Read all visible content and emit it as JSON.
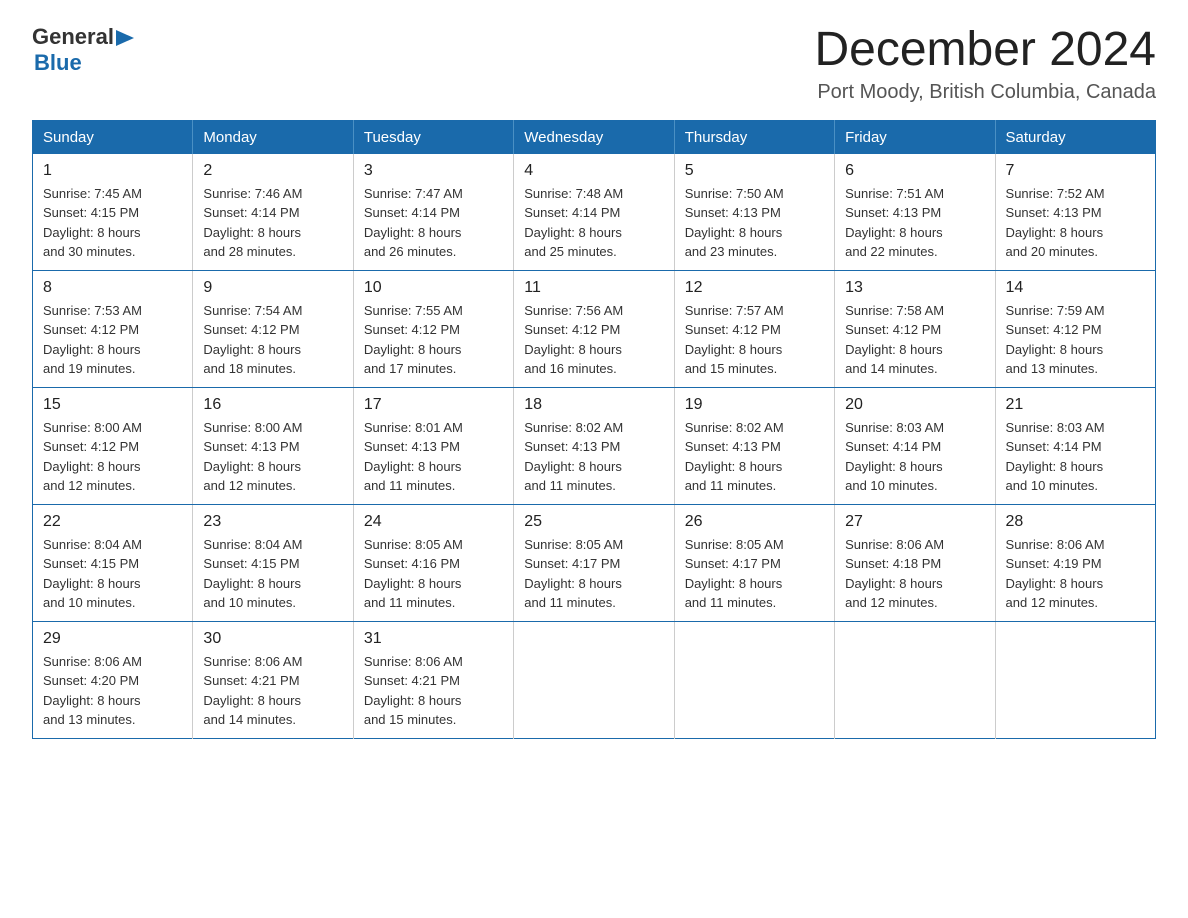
{
  "header": {
    "logo_general": "General",
    "logo_blue": "Blue",
    "month_title": "December 2024",
    "location": "Port Moody, British Columbia, Canada"
  },
  "days_of_week": [
    "Sunday",
    "Monday",
    "Tuesday",
    "Wednesday",
    "Thursday",
    "Friday",
    "Saturday"
  ],
  "weeks": [
    [
      {
        "day": "1",
        "sunrise": "Sunrise: 7:45 AM",
        "sunset": "Sunset: 4:15 PM",
        "daylight": "Daylight: 8 hours",
        "daylight2": "and 30 minutes."
      },
      {
        "day": "2",
        "sunrise": "Sunrise: 7:46 AM",
        "sunset": "Sunset: 4:14 PM",
        "daylight": "Daylight: 8 hours",
        "daylight2": "and 28 minutes."
      },
      {
        "day": "3",
        "sunrise": "Sunrise: 7:47 AM",
        "sunset": "Sunset: 4:14 PM",
        "daylight": "Daylight: 8 hours",
        "daylight2": "and 26 minutes."
      },
      {
        "day": "4",
        "sunrise": "Sunrise: 7:48 AM",
        "sunset": "Sunset: 4:14 PM",
        "daylight": "Daylight: 8 hours",
        "daylight2": "and 25 minutes."
      },
      {
        "day": "5",
        "sunrise": "Sunrise: 7:50 AM",
        "sunset": "Sunset: 4:13 PM",
        "daylight": "Daylight: 8 hours",
        "daylight2": "and 23 minutes."
      },
      {
        "day": "6",
        "sunrise": "Sunrise: 7:51 AM",
        "sunset": "Sunset: 4:13 PM",
        "daylight": "Daylight: 8 hours",
        "daylight2": "and 22 minutes."
      },
      {
        "day": "7",
        "sunrise": "Sunrise: 7:52 AM",
        "sunset": "Sunset: 4:13 PM",
        "daylight": "Daylight: 8 hours",
        "daylight2": "and 20 minutes."
      }
    ],
    [
      {
        "day": "8",
        "sunrise": "Sunrise: 7:53 AM",
        "sunset": "Sunset: 4:12 PM",
        "daylight": "Daylight: 8 hours",
        "daylight2": "and 19 minutes."
      },
      {
        "day": "9",
        "sunrise": "Sunrise: 7:54 AM",
        "sunset": "Sunset: 4:12 PM",
        "daylight": "Daylight: 8 hours",
        "daylight2": "and 18 minutes."
      },
      {
        "day": "10",
        "sunrise": "Sunrise: 7:55 AM",
        "sunset": "Sunset: 4:12 PM",
        "daylight": "Daylight: 8 hours",
        "daylight2": "and 17 minutes."
      },
      {
        "day": "11",
        "sunrise": "Sunrise: 7:56 AM",
        "sunset": "Sunset: 4:12 PM",
        "daylight": "Daylight: 8 hours",
        "daylight2": "and 16 minutes."
      },
      {
        "day": "12",
        "sunrise": "Sunrise: 7:57 AM",
        "sunset": "Sunset: 4:12 PM",
        "daylight": "Daylight: 8 hours",
        "daylight2": "and 15 minutes."
      },
      {
        "day": "13",
        "sunrise": "Sunrise: 7:58 AM",
        "sunset": "Sunset: 4:12 PM",
        "daylight": "Daylight: 8 hours",
        "daylight2": "and 14 minutes."
      },
      {
        "day": "14",
        "sunrise": "Sunrise: 7:59 AM",
        "sunset": "Sunset: 4:12 PM",
        "daylight": "Daylight: 8 hours",
        "daylight2": "and 13 minutes."
      }
    ],
    [
      {
        "day": "15",
        "sunrise": "Sunrise: 8:00 AM",
        "sunset": "Sunset: 4:12 PM",
        "daylight": "Daylight: 8 hours",
        "daylight2": "and 12 minutes."
      },
      {
        "day": "16",
        "sunrise": "Sunrise: 8:00 AM",
        "sunset": "Sunset: 4:13 PM",
        "daylight": "Daylight: 8 hours",
        "daylight2": "and 12 minutes."
      },
      {
        "day": "17",
        "sunrise": "Sunrise: 8:01 AM",
        "sunset": "Sunset: 4:13 PM",
        "daylight": "Daylight: 8 hours",
        "daylight2": "and 11 minutes."
      },
      {
        "day": "18",
        "sunrise": "Sunrise: 8:02 AM",
        "sunset": "Sunset: 4:13 PM",
        "daylight": "Daylight: 8 hours",
        "daylight2": "and 11 minutes."
      },
      {
        "day": "19",
        "sunrise": "Sunrise: 8:02 AM",
        "sunset": "Sunset: 4:13 PM",
        "daylight": "Daylight: 8 hours",
        "daylight2": "and 11 minutes."
      },
      {
        "day": "20",
        "sunrise": "Sunrise: 8:03 AM",
        "sunset": "Sunset: 4:14 PM",
        "daylight": "Daylight: 8 hours",
        "daylight2": "and 10 minutes."
      },
      {
        "day": "21",
        "sunrise": "Sunrise: 8:03 AM",
        "sunset": "Sunset: 4:14 PM",
        "daylight": "Daylight: 8 hours",
        "daylight2": "and 10 minutes."
      }
    ],
    [
      {
        "day": "22",
        "sunrise": "Sunrise: 8:04 AM",
        "sunset": "Sunset: 4:15 PM",
        "daylight": "Daylight: 8 hours",
        "daylight2": "and 10 minutes."
      },
      {
        "day": "23",
        "sunrise": "Sunrise: 8:04 AM",
        "sunset": "Sunset: 4:15 PM",
        "daylight": "Daylight: 8 hours",
        "daylight2": "and 10 minutes."
      },
      {
        "day": "24",
        "sunrise": "Sunrise: 8:05 AM",
        "sunset": "Sunset: 4:16 PM",
        "daylight": "Daylight: 8 hours",
        "daylight2": "and 11 minutes."
      },
      {
        "day": "25",
        "sunrise": "Sunrise: 8:05 AM",
        "sunset": "Sunset: 4:17 PM",
        "daylight": "Daylight: 8 hours",
        "daylight2": "and 11 minutes."
      },
      {
        "day": "26",
        "sunrise": "Sunrise: 8:05 AM",
        "sunset": "Sunset: 4:17 PM",
        "daylight": "Daylight: 8 hours",
        "daylight2": "and 11 minutes."
      },
      {
        "day": "27",
        "sunrise": "Sunrise: 8:06 AM",
        "sunset": "Sunset: 4:18 PM",
        "daylight": "Daylight: 8 hours",
        "daylight2": "and 12 minutes."
      },
      {
        "day": "28",
        "sunrise": "Sunrise: 8:06 AM",
        "sunset": "Sunset: 4:19 PM",
        "daylight": "Daylight: 8 hours",
        "daylight2": "and 12 minutes."
      }
    ],
    [
      {
        "day": "29",
        "sunrise": "Sunrise: 8:06 AM",
        "sunset": "Sunset: 4:20 PM",
        "daylight": "Daylight: 8 hours",
        "daylight2": "and 13 minutes."
      },
      {
        "day": "30",
        "sunrise": "Sunrise: 8:06 AM",
        "sunset": "Sunset: 4:21 PM",
        "daylight": "Daylight: 8 hours",
        "daylight2": "and 14 minutes."
      },
      {
        "day": "31",
        "sunrise": "Sunrise: 8:06 AM",
        "sunset": "Sunset: 4:21 PM",
        "daylight": "Daylight: 8 hours",
        "daylight2": "and 15 minutes."
      },
      null,
      null,
      null,
      null
    ]
  ]
}
